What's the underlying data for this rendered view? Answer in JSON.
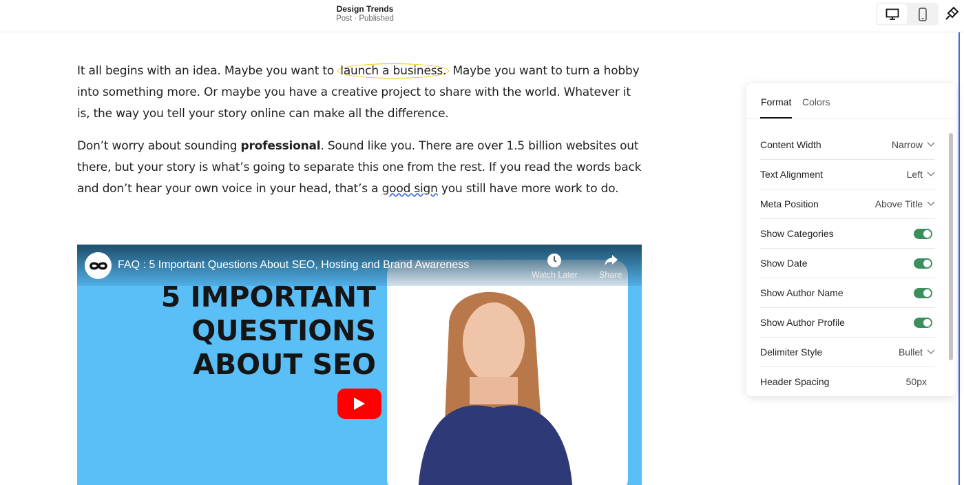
{
  "header": {
    "title": "Design Trends",
    "subtitle": "Post · Published"
  },
  "toolbar": {
    "desktop_icon": "desktop-icon",
    "mobile_icon": "mobile-icon",
    "style_icon": "paintbrush-icon",
    "active_view": "desktop"
  },
  "content": {
    "p1": {
      "before": "It all begins with an idea. Maybe you want to ",
      "highlight": "launch a business.",
      "after": " Maybe you want to turn a hobby into something more. Or maybe you have a creative project to share with the world. Whatever it is, the way you tell your story online can make all the difference."
    },
    "p2": {
      "a": "Don’t worry about sounding ",
      "bold": "professional",
      "b": ". Sound like you. There are over 1.5 billion websites out there, but your story is what’s going to separate this one from the rest. If you read the words back and don’t hear your own voice in your head, that’s a ",
      "wavy": "good sign",
      "c": " you still have more work to do."
    }
  },
  "video": {
    "title": "FAQ : 5 Important Questions About SEO, Hosting and Brand Awareness",
    "headline_1": "5 IMPORTANT",
    "headline_2": "QUESTIONS",
    "headline_3": "ABOUT SEO",
    "watch_later": "Watch Later",
    "share": "Share",
    "bg_color": "#5bbff7"
  },
  "panel": {
    "tabs": [
      {
        "label": "Format",
        "active": true
      },
      {
        "label": "Colors",
        "active": false
      }
    ],
    "settings": [
      {
        "label": "Content Width",
        "value": "Narrow",
        "type": "dropdown"
      },
      {
        "label": "Text Alignment",
        "value": "Left",
        "type": "dropdown"
      },
      {
        "label": "Meta Position",
        "value": "Above Title",
        "type": "dropdown"
      },
      {
        "label": "Show Categories",
        "value": true,
        "type": "toggle"
      },
      {
        "label": "Show Date",
        "value": true,
        "type": "toggle"
      },
      {
        "label": "Show Author Name",
        "value": true,
        "type": "toggle"
      },
      {
        "label": "Show Author Profile",
        "value": true,
        "type": "toggle"
      },
      {
        "label": "Delimiter Style",
        "value": "Bullet",
        "type": "dropdown"
      },
      {
        "label": "Header Spacing",
        "value": "50px",
        "type": "value"
      }
    ],
    "toggle_color": "#3b8f5f"
  }
}
